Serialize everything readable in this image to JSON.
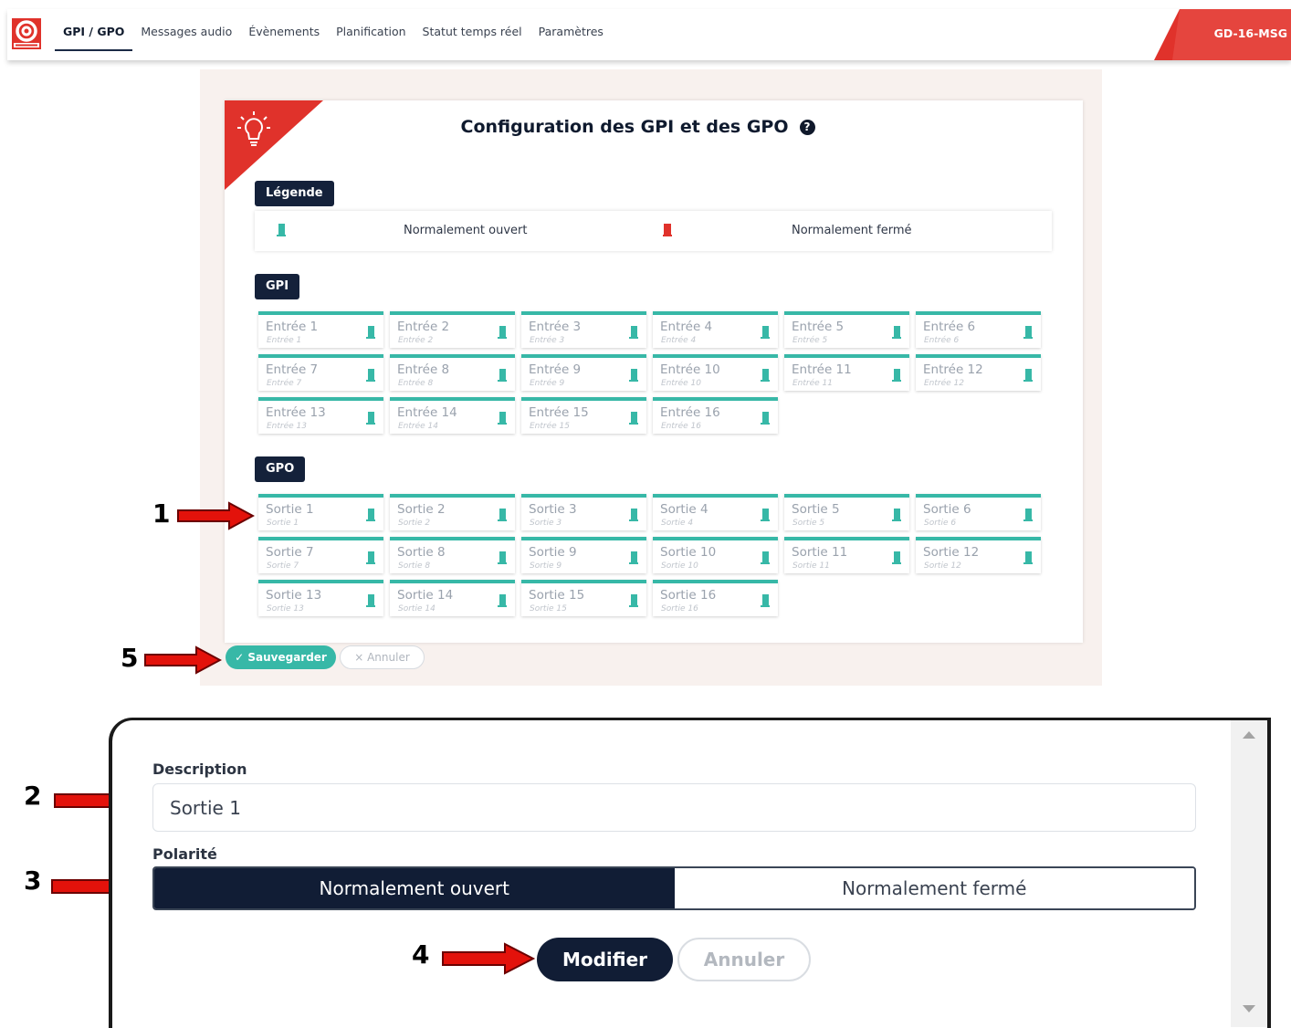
{
  "colors": {
    "accent": "#37b8a7",
    "navy": "#111d35",
    "brand_red": "#e0322b",
    "arrow_red": "#e3120b"
  },
  "nav": {
    "items": [
      "GPI / GPO",
      "Messages audio",
      "Évènements",
      "Planification",
      "Statut temps réel",
      "Paramètres"
    ],
    "active_index": 0,
    "device_name": "GD-16-MSG"
  },
  "panel": {
    "title": "Configuration des GPI et des GPO",
    "help_icon": "?",
    "legend_label": "Légende",
    "legend": {
      "open": "Normalement ouvert",
      "closed": "Normalement fermé"
    },
    "gpi_label": "GPI",
    "gpo_label": "GPO",
    "gpi": [
      {
        "name": "Entrée 1",
        "desc": "Entrée 1"
      },
      {
        "name": "Entrée 2",
        "desc": "Entrée 2"
      },
      {
        "name": "Entrée 3",
        "desc": "Entrée 3"
      },
      {
        "name": "Entrée 4",
        "desc": "Entrée 4"
      },
      {
        "name": "Entrée 5",
        "desc": "Entrée 5"
      },
      {
        "name": "Entrée 6",
        "desc": "Entrée 6"
      },
      {
        "name": "Entrée 7",
        "desc": "Entrée 7"
      },
      {
        "name": "Entrée 8",
        "desc": "Entrée 8"
      },
      {
        "name": "Entrée 9",
        "desc": "Entrée 9"
      },
      {
        "name": "Entrée 10",
        "desc": "Entrée 10"
      },
      {
        "name": "Entrée 11",
        "desc": "Entrée 11"
      },
      {
        "name": "Entrée 12",
        "desc": "Entrée 12"
      },
      {
        "name": "Entrée 13",
        "desc": "Entrée 13"
      },
      {
        "name": "Entrée 14",
        "desc": "Entrée 14"
      },
      {
        "name": "Entrée 15",
        "desc": "Entrée 15"
      },
      {
        "name": "Entrée 16",
        "desc": "Entrée 16"
      }
    ],
    "gpo": [
      {
        "name": "Sortie 1",
        "desc": "Sortie 1"
      },
      {
        "name": "Sortie 2",
        "desc": "Sortie 2"
      },
      {
        "name": "Sortie 3",
        "desc": "Sortie 3"
      },
      {
        "name": "Sortie 4",
        "desc": "Sortie 4"
      },
      {
        "name": "Sortie 5",
        "desc": "Sortie 5"
      },
      {
        "name": "Sortie 6",
        "desc": "Sortie 6"
      },
      {
        "name": "Sortie 7",
        "desc": "Sortie 7"
      },
      {
        "name": "Sortie 8",
        "desc": "Sortie 8"
      },
      {
        "name": "Sortie 9",
        "desc": "Sortie 9"
      },
      {
        "name": "Sortie 10",
        "desc": "Sortie 10"
      },
      {
        "name": "Sortie 11",
        "desc": "Sortie 11"
      },
      {
        "name": "Sortie 12",
        "desc": "Sortie 12"
      },
      {
        "name": "Sortie 13",
        "desc": "Sortie 13"
      },
      {
        "name": "Sortie 14",
        "desc": "Sortie 14"
      },
      {
        "name": "Sortie 15",
        "desc": "Sortie 15"
      },
      {
        "name": "Sortie 16",
        "desc": "Sortie 16"
      }
    ],
    "save_label": "✓ Sauvegarder",
    "cancel_label": "× Annuler"
  },
  "modal": {
    "description_label": "Description",
    "description_value": "Sortie 1",
    "polarity_label": "Polarité",
    "polarity_options": [
      "Normalement ouvert",
      "Normalement fermé"
    ],
    "polarity_selected": 0,
    "modify_label": "Modifier",
    "cancel_label": "Annuler"
  },
  "annotations": [
    "1",
    "2",
    "3",
    "4",
    "5"
  ]
}
